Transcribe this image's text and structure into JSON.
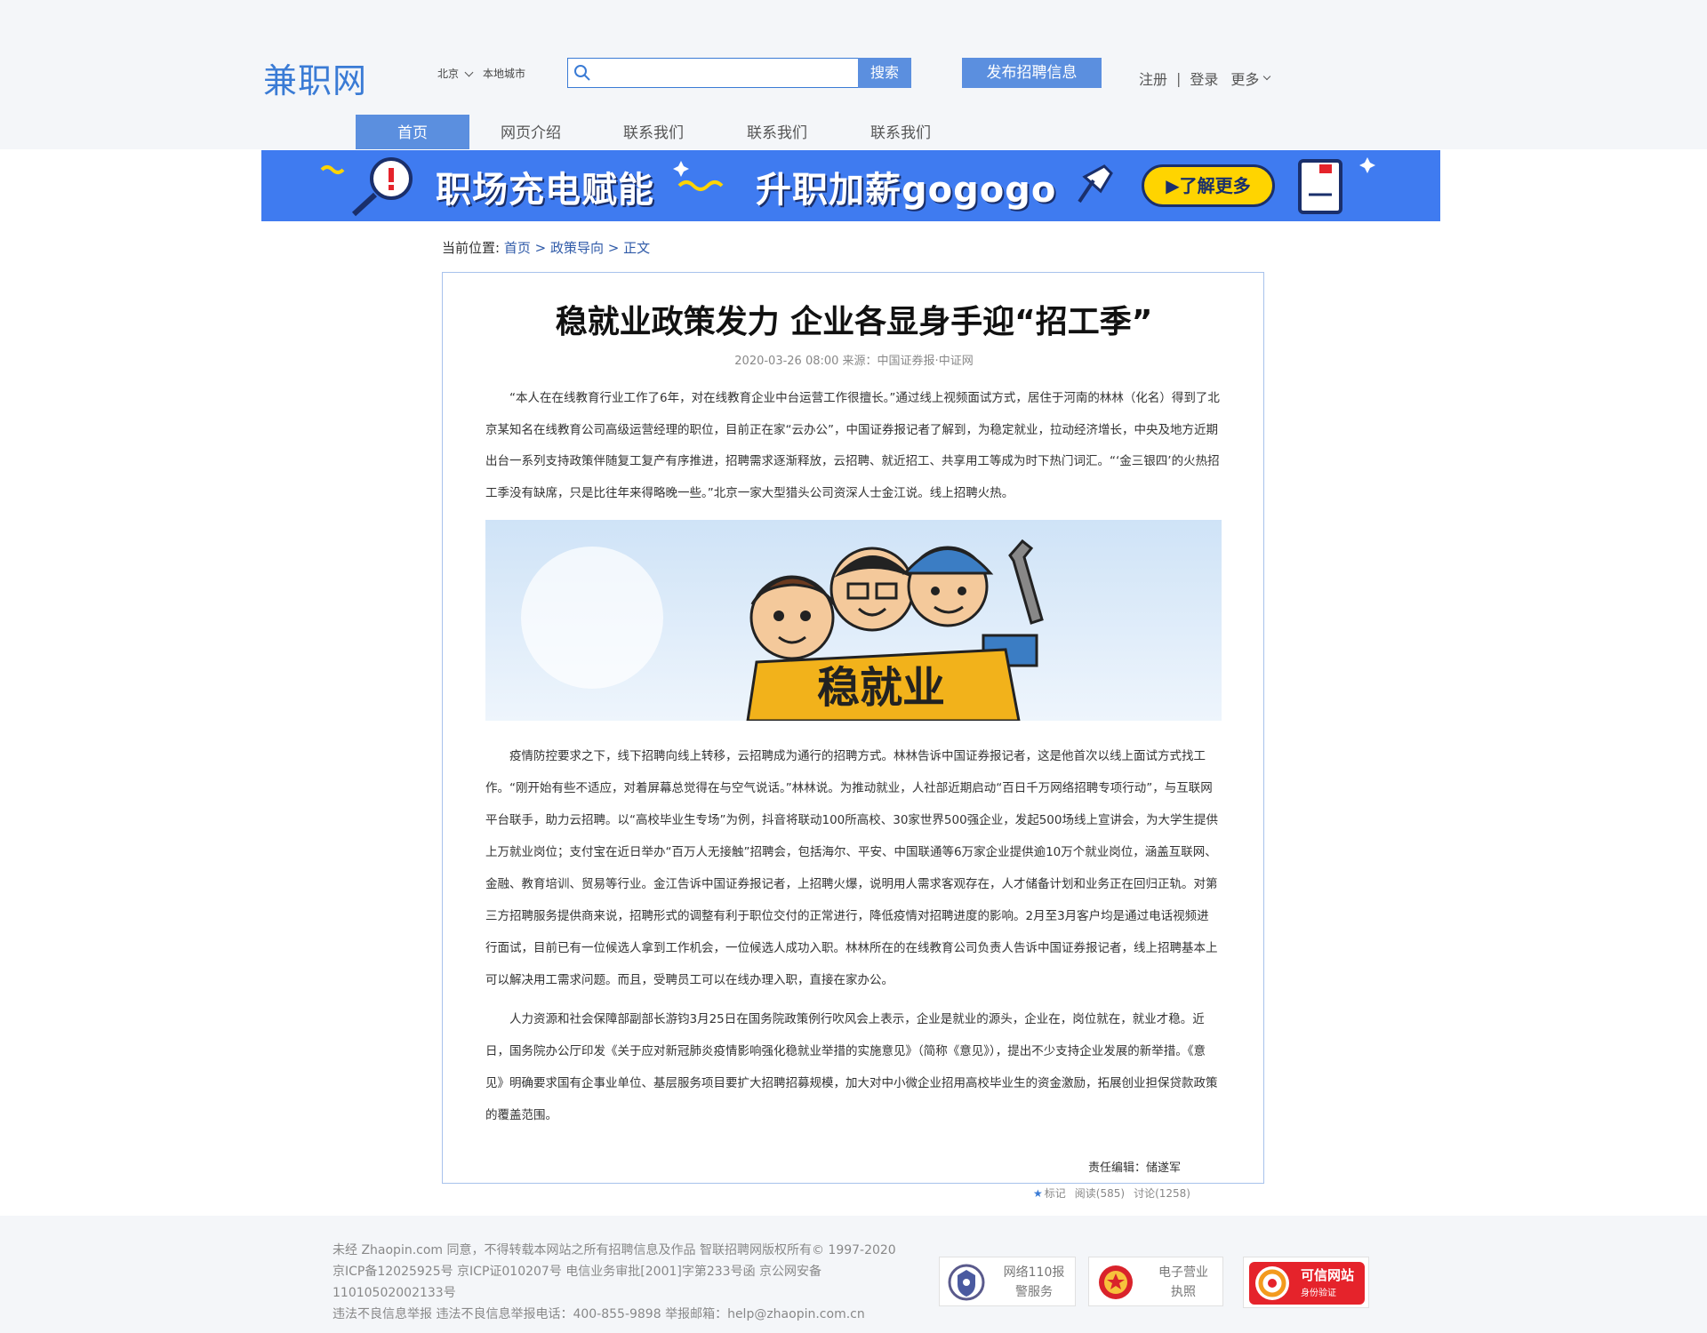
{
  "header": {
    "logo": "兼职网",
    "city": "北京",
    "city_local": "本地城市",
    "search_placeholder": "",
    "search_button": "搜索",
    "post_button": "发布招聘信息",
    "register": "注册",
    "divider": "|",
    "login": "登录",
    "more": "更多"
  },
  "nav": {
    "items": [
      {
        "label": "首页",
        "active": true
      },
      {
        "label": "网页介绍",
        "active": false
      },
      {
        "label": "联系我们",
        "active": false
      },
      {
        "label": "联系我们",
        "active": false
      },
      {
        "label": "联系我们",
        "active": false
      }
    ]
  },
  "banner": {
    "text1": "职场充电赋能",
    "text2": "升职加薪gogogo",
    "button": "▶了解更多"
  },
  "breadcrumb": {
    "prefix": "当前位置:",
    "home": "首页",
    "sep1": ">",
    "section": "政策导向",
    "sep2": ">",
    "current": "正文"
  },
  "article": {
    "title": "稳就业政策发力 企业各显身手迎“招工季”",
    "meta": "2020-03-26  08:00 来源：中国证券报·中证网",
    "paragraphs": [
      "“本人在在线教育行业工作了6年，对在线教育企业中台运营工作很擅长。”通过线上视频面试方式，居住于河南的林林（化名）得到了北京某知名在线教育公司高级运营经理的职位，目前正在家“云办公”，中国证券报记者了解到，为稳定就业，拉动经济增长，中央及地方近期出台一系列支持政策伴随复工复产有序推进，招聘需求逐渐释放，云招聘、就近招工、共享用工等成为时下热门词汇。“‘金三银四’的火热招工季没有缺席，只是比往年来得略晚一些。”北京一家大型猎头公司资深人士金江说。线上招聘火热。",
      "疫情防控要求之下，线下招聘向线上转移，云招聘成为通行的招聘方式。林林告诉中国证券报记者，这是他首次以线上面试方式找工作。“刚开始有些不适应，对着屏幕总觉得在与空气说话。”林林说。为推动就业，人社部近期启动“百日千万网络招聘专项行动”，与互联网平台联手，助力云招聘。以“高校毕业生专场”为例，抖音将联动100所高校、30家世界500强企业，发起500场线上宣讲会，为大学生提供上万就业岗位；支付宝在近日举办“百万人无接触”招聘会，包括海尔、平安、中国联通等6万家企业提供逾10万个就业岗位，涵盖互联网、金融、教育培训、贸易等行业。金江告诉中国证券报记者，上招聘火爆，说明用人需求客观存在，人才储备计划和业务正在回归正轨。对第三方招聘服务提供商来说，招聘形式的调整有利于职位交付的正常进行，降低疫情对招聘进度的影响。2月至3月客户均是通过电话视频进行面试，目前已有一位候选人拿到工作机会，一位候选人成功入职。林林所在的在线教育公司负责人告诉中国证券报记者，线上招聘基本上可以解决用工需求问题。而且，受聘员工可以在线办理入职，直接在家办公。",
      "人力资源和社会保障部副部长游钧3月25日在国务院政策例行吹风会上表示，企业是就业的源头，企业在，岗位就在，就业才稳。近日，国务院办公厅印发《关于应对新冠肺炎疫情影响强化稳就业举措的实施意见》（简称《意见》），提出不少支持企业发展的新举措。《意见》明确要求国有企事业单位、基层服务项目要扩大招聘招募规模，加大对中小微企业招用高校毕业生的资金激励，拓展创业担保贷款政策的覆盖范围。"
    ],
    "image_caption": "稳就业",
    "editor": "责任编辑：储遂军"
  },
  "stats": {
    "mark": "标记",
    "reads": "阅读(585)",
    "comments": "讨论(1258)"
  },
  "footer": {
    "line1": "未经 Zhaopin.com 同意，不得转载本网站之所有招聘信息及作品 智联招聘网版权所有© 1997-2020",
    "line2": "京ICP备12025925号 京ICP证010207号 电信业务审批[2001]字第233号函 京公网安备 11010502002133号",
    "line3": "违法不良信息举报 违法不良信息举报电话：400-855-9898 举报邮箱：help@zhaopin.com.cn",
    "badge1_l1": "网络110报",
    "badge1_l2": "警服务",
    "badge2_l1": "电子营业",
    "badge2_l2": "执照",
    "trust_l1": "可信网站",
    "trust_l2": "身份验证"
  },
  "colors": {
    "accent": "#5b8fdf",
    "logo": "#3a7bd5",
    "banner_bg": "#3f7bf0",
    "banner_button": "#ffd400",
    "article_border": "#a8c2ec",
    "trust_red": "#e5232b"
  }
}
